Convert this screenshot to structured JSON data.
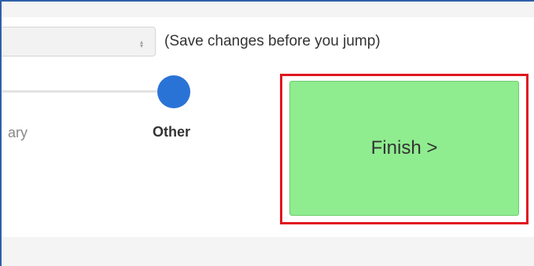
{
  "jump": {
    "hint": "(Save changes before you jump)",
    "arrow_icon": "up-down-arrows-icon"
  },
  "slider": {
    "labels": [
      "ary",
      "Other"
    ],
    "selected_label": "Other"
  },
  "finish": {
    "label": "Finish >"
  },
  "colors": {
    "border_blue": "#2f5fa8",
    "handle_blue": "#2a73d6",
    "finish_green": "#8fec8f",
    "highlight_red": "#e0161f"
  }
}
